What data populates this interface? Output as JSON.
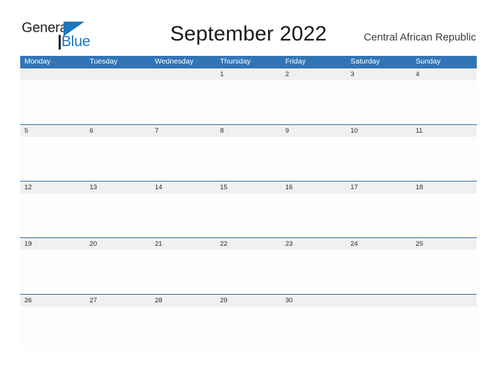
{
  "header": {
    "logo": {
      "text_primary": "General",
      "text_secondary": "Blue",
      "flag_icon": "blue-triangle-flag-icon",
      "flag_color": "#1b75bc"
    },
    "title": "September 2022",
    "country": "Central African Republic"
  },
  "calendar": {
    "weekdays": [
      "Monday",
      "Tuesday",
      "Wednesday",
      "Thursday",
      "Friday",
      "Saturday",
      "Sunday"
    ],
    "weeks": [
      [
        "",
        "",
        "",
        "1",
        "2",
        "3",
        "4"
      ],
      [
        "5",
        "6",
        "7",
        "8",
        "9",
        "10",
        "11"
      ],
      [
        "12",
        "13",
        "14",
        "15",
        "16",
        "17",
        "18"
      ],
      [
        "19",
        "20",
        "21",
        "22",
        "23",
        "24",
        "25"
      ],
      [
        "26",
        "27",
        "28",
        "29",
        "30",
        "",
        ""
      ]
    ]
  },
  "colors": {
    "header_blue": "#3275b6",
    "band_gray": "#f0f0f0",
    "rule_blue": "#2e6da4",
    "logo_blue": "#1b75bc",
    "text_dark": "#231f20"
  }
}
